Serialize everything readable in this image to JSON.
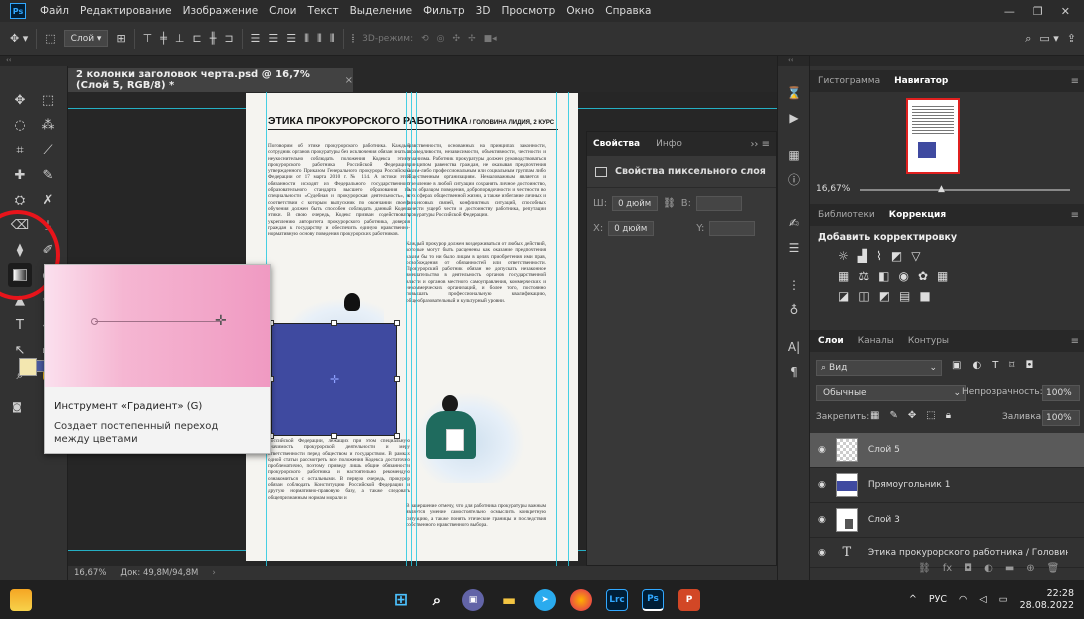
{
  "menubar": {
    "logo": "Ps",
    "items": [
      "Файл",
      "Редактирование",
      "Изображение",
      "Слои",
      "Текст",
      "Выделение",
      "Фильтр",
      "3D",
      "Просмотр",
      "Окно",
      "Справка"
    ]
  },
  "options": {
    "layer_select": "Слой",
    "mode3d": "3D-режим:"
  },
  "doc_tab": {
    "title": "2 колонки заголовок черта.psd @ 16,7% (Слой 5, RGB/8) *",
    "close": "×"
  },
  "document": {
    "title": "ЭТИКА ПРОКУРОРСКОГО РАБОТНИКА",
    "subtitle": " / ГОЛОВИНА ЛИДИЯ, 2 КУРС",
    "col1": "Поговорим об этике прокурорского работника. Каждый сотрудник органов прокуратуры без исключения обязан знать и неукоснительно соблюдать положения Кодекса этики прокурорского работника Российской Федерации, утвержденного Приказом Генерального прокурора Российской Федерации от 17 марта 2010 г. № 114. А истоки этой обязанности исходят из Федерального государственного образовательного стандарта высшего образования по специальности «Судебная и прокурорская деятельность», в соответствии с которым выпускник по окончании своего обучения должен быть способен соблюдать данный Кодекс этики. В свою очередь, Кодекс призван содействовать укреплению авторитета прокурорского работника, доверия граждан к государству и обеспечить единую нравственно-нормативную основу поведения прокурорских работников.",
    "col1b": "Российской Федерации, лежащих при этом специальную значимость прокурорской деятельности и меру ответственности перед обществом и государством. В рамках одной статьи рассмотреть все положения Кодекса достаточно проблематично, поэтому приведу лишь общие обязанности прокурорского работника и настоятельно рекомендую ознакомиться с остальными. В первую очередь, прокурор обязан соблюдать Конституцию Российской Федерации и другую нормативно-правовую базу, а также следовать общепризнанным нормам морали и",
    "col2": "нравственности, основанных на принципах законности, справедливости, независимости, объективности, честности и гуманизма. Работник прокуратуры должен руководствоваться принципом равенства граждан, не оказывая предпочтения каким-либо профессиональным или социальным группам либо общественным организациям. Немаловажным является и стремление в любой ситуации сохранять личное достоинство, быть образцом поведения, добропорядочности и честности во всех сферах общественной жизни, а также избегание личных и финансовых связей, конфликтных ситуаций, способных нанести ущерб чести и достоинству работника, репутации прокуратуры Российской Федерации.",
    "col2b": "Каждый прокурор должен воздерживаться от любых действий, которые могут быть расценены как оказание предпочтения каким бы то ни было лицам в целях приобретения ими прав, освобождения от обязанностей или ответственности. Прокурорский работник обязан не допускать незаконное вмешательство в деятельность органов государственной власти и органов местного самоуправления, коммерческих и некоммерческих организаций, и более того, постоянно повышать профессиональную квалификацию, общеобразовательный и культурный уровни.",
    "col2c": "В завершение отмечу, что для работника прокуратуры важным является умение самостоятельно осмыслить конкретную ситуацию, а также понять этические границы и последствия собственного нравственного выбора."
  },
  "status": {
    "zoom": "16,67%",
    "doc": "Док: 49,8M/94,8M"
  },
  "tooltip": {
    "title": "Инструмент «Градиент» (G)",
    "desc": "Создает постепенный переход между цветами"
  },
  "properties": {
    "tabs": [
      "Свойства",
      "Инфо"
    ],
    "header": "Свойства пиксельного слоя",
    "w_label": "Ш:",
    "w_value": "0 дюйм",
    "b_label": "В:",
    "x_label": "X:",
    "x_value": "0 дюйм",
    "y_label": "Y:"
  },
  "navigator": {
    "tabs": [
      "Гистограмма",
      "Навигатор"
    ],
    "zoom": "16,67%"
  },
  "adjust": {
    "tabs": [
      "Библиотеки",
      "Коррекция"
    ],
    "title": "Добавить корректировку"
  },
  "layers": {
    "tabs": [
      "Слои",
      "Каналы",
      "Контуры"
    ],
    "search": "Вид",
    "blend": "Обычные",
    "opacity_label": "Непрозрачность:",
    "opacity": "100%",
    "lock_label": "Закрепить:",
    "fill_label": "Заливка:",
    "fill": "100%",
    "items": [
      "Слой 5",
      "Прямоугольник 1",
      "Слой 3",
      "Этика прокурорского работника / Головина Л..."
    ]
  },
  "taskbar": {
    "lang": "РУС",
    "time": "22:28",
    "date": "28.08.2022"
  },
  "colors": {
    "accent": "#31a8ff",
    "selection": "#3f4aa0",
    "pink": "#f09ac2",
    "circle": "#e8141b",
    "guide": "#26c8e0"
  }
}
